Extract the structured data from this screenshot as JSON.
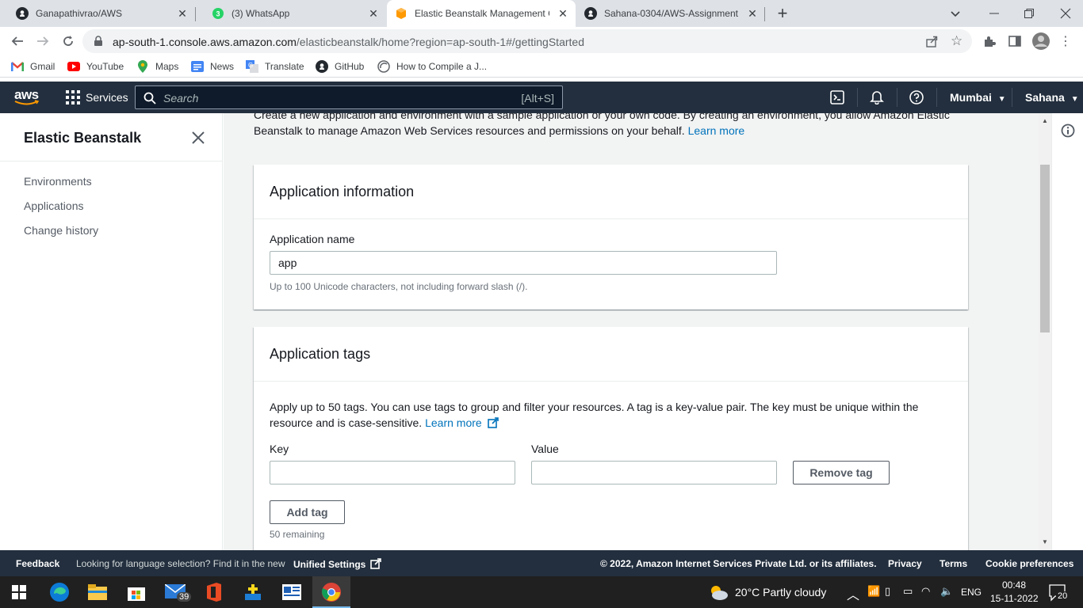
{
  "browser": {
    "tabs": [
      {
        "title": "Ganapathivrao/AWS",
        "icon": "github-icon"
      },
      {
        "title": "(3) WhatsApp",
        "icon": "whatsapp-icon",
        "badge": "3"
      },
      {
        "title": "Elastic Beanstalk Management C",
        "icon": "aws-beanstalk-icon"
      },
      {
        "title": "Sahana-0304/AWS-Assignment",
        "icon": "github-icon"
      }
    ],
    "url_host": "ap-south-1.console.aws.amazon.com",
    "url_path": "/elasticbeanstalk/home?region=ap-south-1#/gettingStarted",
    "bookmarks": [
      "Gmail",
      "YouTube",
      "Maps",
      "News",
      "Translate",
      "GitHub",
      "How to Compile a J..."
    ]
  },
  "aws_nav": {
    "logo": "aws",
    "services": "Services",
    "search_placeholder": "Search",
    "search_shortcut": "[Alt+S]",
    "region": "Mumbai",
    "user": "Sahana"
  },
  "sidebar": {
    "title": "Elastic Beanstalk",
    "items": [
      "Environments",
      "Applications",
      "Change history"
    ]
  },
  "main": {
    "intro_line1": "Create a new application and environment with a sample application or your own code. By creating an environment, you allow Amazon Elastic",
    "intro_line2": "Beanstalk to manage Amazon Web Services resources and permissions on your behalf.",
    "intro_link": "Learn more",
    "app_info": {
      "title": "Application information",
      "name_label": "Application name",
      "name_value": "app",
      "name_hint": "Up to 100 Unicode characters, not including forward slash (/)."
    },
    "app_tags": {
      "title": "Application tags",
      "desc_line1": "Apply up to 50 tags. You can use tags to group and filter your resources. A tag is a key-value pair. The key must be unique within the",
      "desc_line2": "resource and is case-sensitive.",
      "learn_more": "Learn more",
      "key_label": "Key",
      "value_label": "Value",
      "key_value": "",
      "value_value": "",
      "remove_tag": "Remove tag",
      "add_tag": "Add tag",
      "remaining": "50 remaining"
    }
  },
  "footer": {
    "feedback": "Feedback",
    "language_prompt": "Looking for language selection? Find it in the new",
    "unified_settings": "Unified Settings",
    "copyright": "© 2022, Amazon Internet Services Private Ltd. or its affiliates.",
    "privacy": "Privacy",
    "terms": "Terms",
    "cookies": "Cookie preferences"
  },
  "taskbar": {
    "mail_badge": "39",
    "weather": "20°C  Partly cloudy",
    "language": "ENG",
    "time": "00:48",
    "date": "15-11-2022",
    "notifications": "20"
  },
  "colors": {
    "aws_nav": "#232f3e",
    "link": "#0073bb",
    "page_bg": "#f2f3f3"
  }
}
